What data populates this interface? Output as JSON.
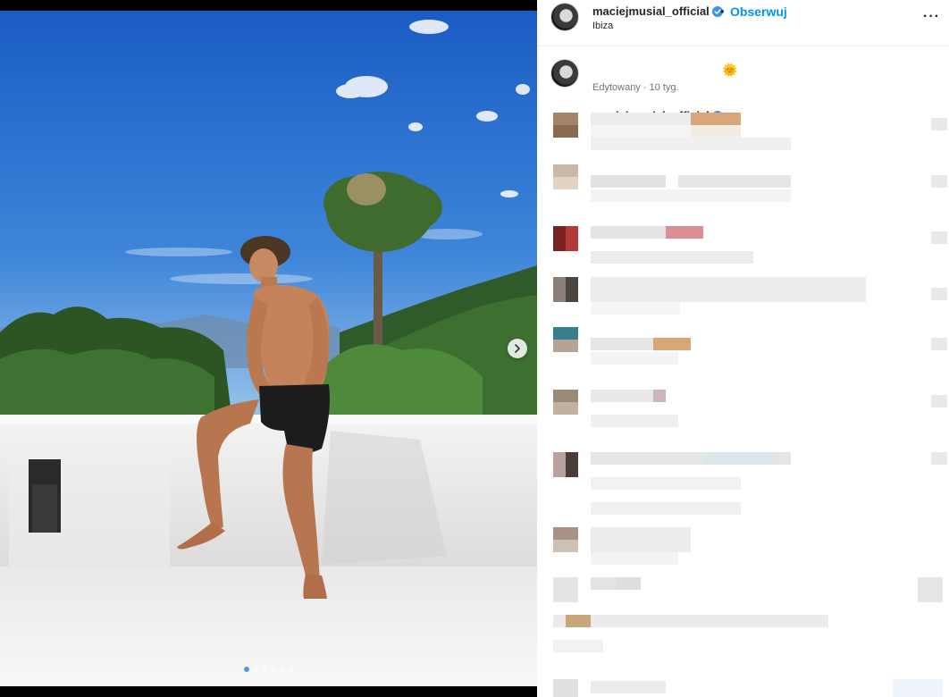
{
  "post": {
    "username": "maciejmusial_official",
    "follow_label": "Obserwuj",
    "separator": "•",
    "location": "Ibiza",
    "more_label": "···",
    "caption_username": "maciejmusial_official",
    "caption_emoji": "🌞",
    "edited_label": "Edytowany · 10 tyg."
  },
  "media": {
    "carousel_count": 6,
    "carousel_active": 0,
    "next_icon": "chevron-right-icon"
  },
  "colors": {
    "link": "#0095f6",
    "verified": "#3897f0",
    "sky_top": "#1d62c9",
    "sky_bottom": "#6fa6e2"
  }
}
